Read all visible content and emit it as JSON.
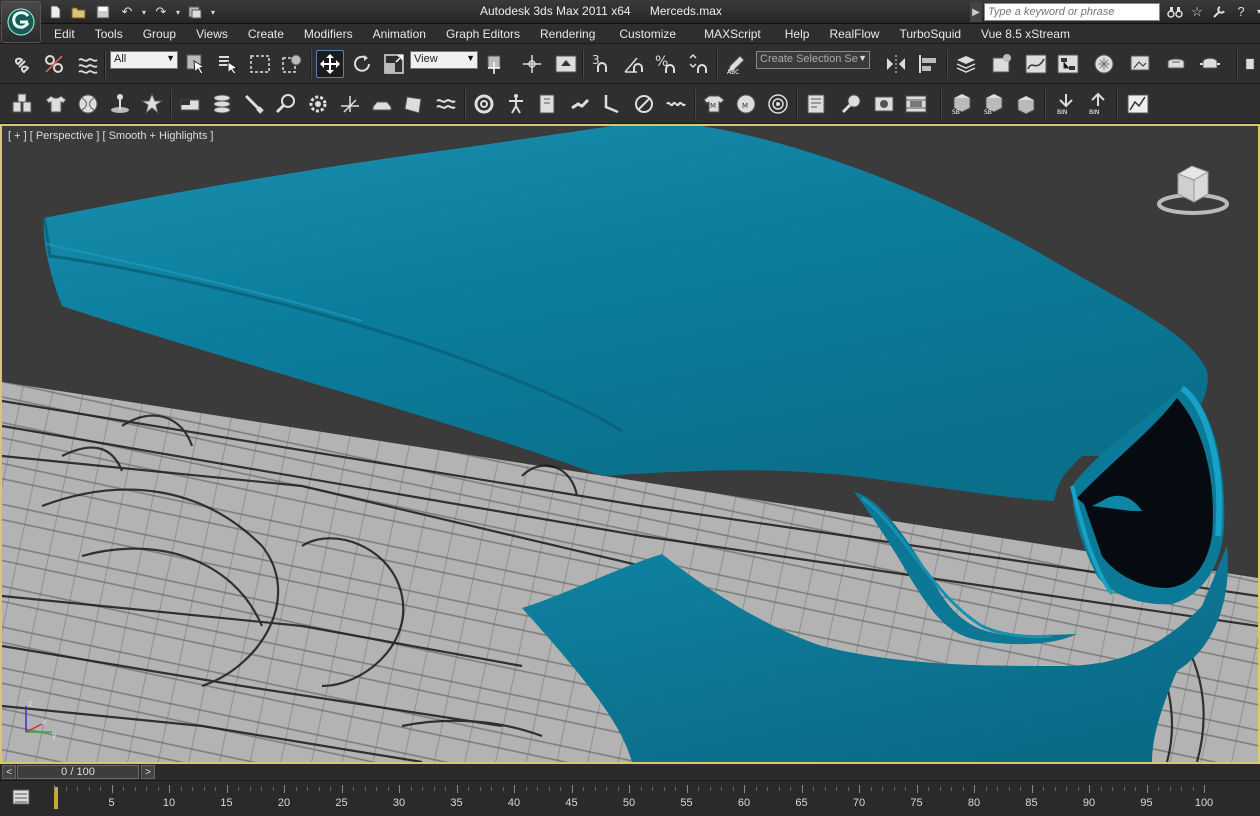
{
  "window": {
    "app_name": "Autodesk 3ds Max  2011 x64",
    "file_name": "Merceds.max"
  },
  "search": {
    "placeholder": "Type a keyword or phrase"
  },
  "quick_access": [
    "new-icon",
    "open-icon",
    "save-icon",
    "undo-icon",
    "redo-icon",
    "project-folder-icon"
  ],
  "menu": {
    "items": [
      "Edit",
      "Tools",
      "Group",
      "Views",
      "Create",
      "Modifiers",
      "Animation",
      "Graph Editors",
      "Rendering",
      "Customize",
      "MAXScript",
      "Help",
      "RealFlow",
      "TurboSquid",
      "Vue 8.5 xStream"
    ]
  },
  "toolbar": {
    "selection_filter": "All",
    "reference_coord": "View",
    "selection_set_placeholder": "Create Selection Se",
    "snap_label": "3",
    "angle_snap_label": "",
    "percent_snap_label": "%"
  },
  "viewport": {
    "label": "[ + ] [ Perspective ] [ Smooth + Highlights ]",
    "object_color": "#0e87a8",
    "background_color": "#3b3b3b",
    "ground_color": "#b3b3b3",
    "border_color": "#d8c86a"
  },
  "time_slider": {
    "position": "0 / 100",
    "prev_label": "<",
    "next_label": ">"
  },
  "trackbar": {
    "ticks": [
      "0",
      "5",
      "10",
      "15",
      "20",
      "25",
      "30",
      "35",
      "40",
      "45",
      "50",
      "55",
      "60",
      "65",
      "70",
      "75",
      "80",
      "85",
      "90",
      "95",
      "100"
    ],
    "current_frame": 0
  }
}
